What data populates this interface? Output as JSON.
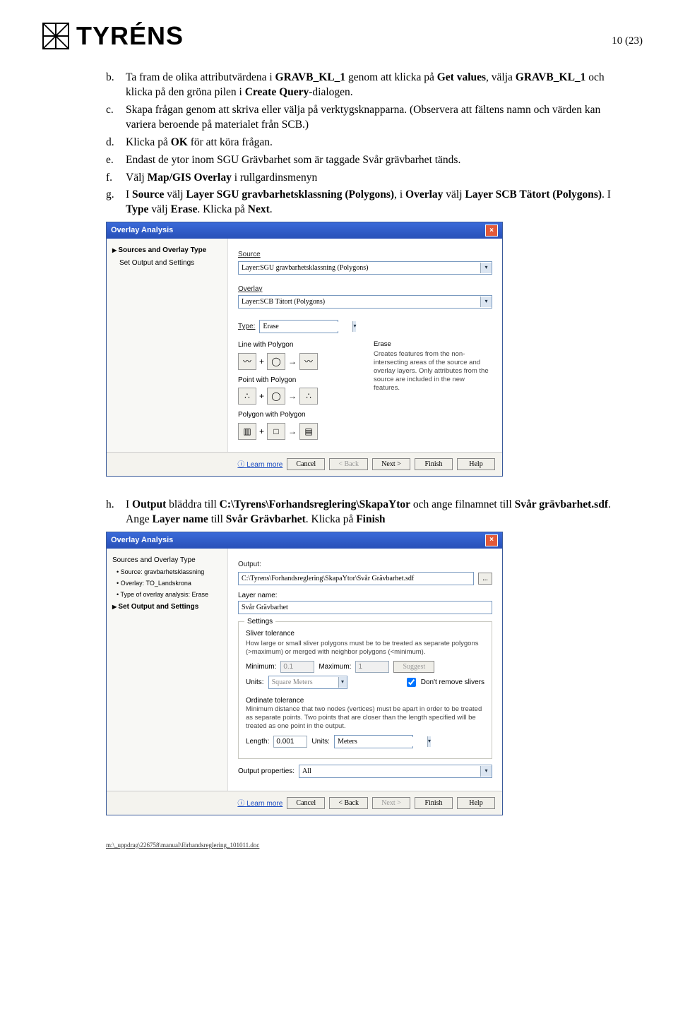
{
  "pageNum": "10 (23)",
  "logoText": "TYRÉNS",
  "list": {
    "b": {
      "marker": "b.",
      "pre": "Ta fram de olika attributvärdena i ",
      "t1": "GRAVB_KL_1",
      "mid1": " genom att klicka på ",
      "t2": "Get values",
      "mid2": ", välja ",
      "t3": "GRAVB_KL_1",
      "mid3": " och klicka på den gröna pilen i ",
      "t4": "Create Query",
      "post": "-dialogen."
    },
    "c": {
      "marker": "c.",
      "text": "Skapa frågan genom att skriva eller välja på verktygsknapparna. (Observera att fältens namn och värden kan variera beroende på materialet från SCB.)"
    },
    "d": {
      "marker": "d.",
      "pre": "Klicka på ",
      "t1": "OK",
      "post": " för att köra frågan."
    },
    "e": {
      "marker": "e.",
      "text": "Endast de ytor inom SGU Grävbarhet som är taggade Svår grävbarhet tänds."
    },
    "f": {
      "marker": "f.",
      "pre": "Välj ",
      "t1": "Map/GIS Overlay",
      "post": " i rullgardinsmenyn"
    },
    "g": {
      "marker": "g.",
      "pre": "I ",
      "t1": "Source",
      "mid1": " välj ",
      "t2": "Layer SGU gravbarhetsklassning (Polygons)",
      "mid2": ", i ",
      "t3": "Overlay",
      "mid3": " välj ",
      "t4": "Layer SCB Tätort (Polygons)",
      "mid4": ". I ",
      "t5": "Type",
      "mid5": " välj ",
      "t6": "Erase",
      "mid6": ". Klicka på ",
      "t7": "Next",
      "post": "."
    },
    "h": {
      "marker": "h.",
      "pre": "I ",
      "t1": "Output",
      "mid1": " bläddra till ",
      "t2": "C:\\Tyrens\\Forhandsreglering\\SkapaYtor",
      "mid2": " och ange filnamnet till ",
      "t3": "Svår grävbarhet.sdf",
      "mid3": ". Ange ",
      "t4": "Layer name",
      "mid4": " till ",
      "t5": "Svår Grävbarhet",
      "mid5": ". Klicka på ",
      "t6": "Finish"
    }
  },
  "dlg1": {
    "title": "Overlay Analysis",
    "side1": "Sources and Overlay Type",
    "side2": "Set Output and Settings",
    "sourceLabel": "Source",
    "sourceVal": "Layer:SGU gravbarhetsklassning (Polygons)",
    "overlayLabel": "Overlay",
    "overlayVal": "Layer:SCB Tätort (Polygons)",
    "typeLabel": "Type:",
    "typeVal": "Erase",
    "r1": "Line with Polygon",
    "r2": "Point with Polygon",
    "r3": "Polygon with Polygon",
    "descH": "Erase",
    "desc": "Creates features from the non-intersecting areas of the source and overlay layers. Only attributes from the source are included in the new features.",
    "learn": "Learn more",
    "cancel": "Cancel",
    "back": "< Back",
    "next": "Next >",
    "finish": "Finish",
    "help": "Help"
  },
  "dlg2": {
    "title": "Overlay Analysis",
    "side1": "Sources and Overlay Type",
    "side1a": "Source: gravbarhetsklassning",
    "side1b": "Overlay: TO_Landskrona",
    "side1c": "Type of overlay analysis: Erase",
    "side2": "Set Output and Settings",
    "outputLabel": "Output:",
    "outputVal": "C:\\Tyrens\\Forhandsreglering\\SkapaYtor\\Svår Grävbarhet.sdf",
    "layerLabel": "Layer name:",
    "layerVal": "Svår Grävbarhet",
    "settings": "Settings",
    "sliverH": "Sliver tolerance",
    "sliverD": "How large or small sliver polygons must be to be treated as separate polygons (>maximum) or merged with neighbor polygons (<minimum).",
    "min": "Minimum:",
    "minV": "0.1",
    "max": "Maximum:",
    "maxV": "1",
    "suggest": "Suggest",
    "units": "Units:",
    "unitsV": "Square Meters",
    "dontRemove": "Don't remove slivers",
    "ordH": "Ordinate tolerance",
    "ordD": "Minimum distance that two nodes (vertices) must be apart in order to be treated as separate points. Two points that are closer than the length specified will be treated as one point in the output.",
    "len": "Length:",
    "lenV": "0.001",
    "units2": "Units:",
    "units2V": "Meters",
    "outprop": "Output properties:",
    "outpropV": "All",
    "learn": "Learn more",
    "cancel": "Cancel",
    "back": "< Back",
    "next": "Next >",
    "finish": "Finish",
    "help": "Help"
  },
  "footerPath": "m:\\_uppdrag\\226758\\manual\\förhandsreglering_101011.doc"
}
